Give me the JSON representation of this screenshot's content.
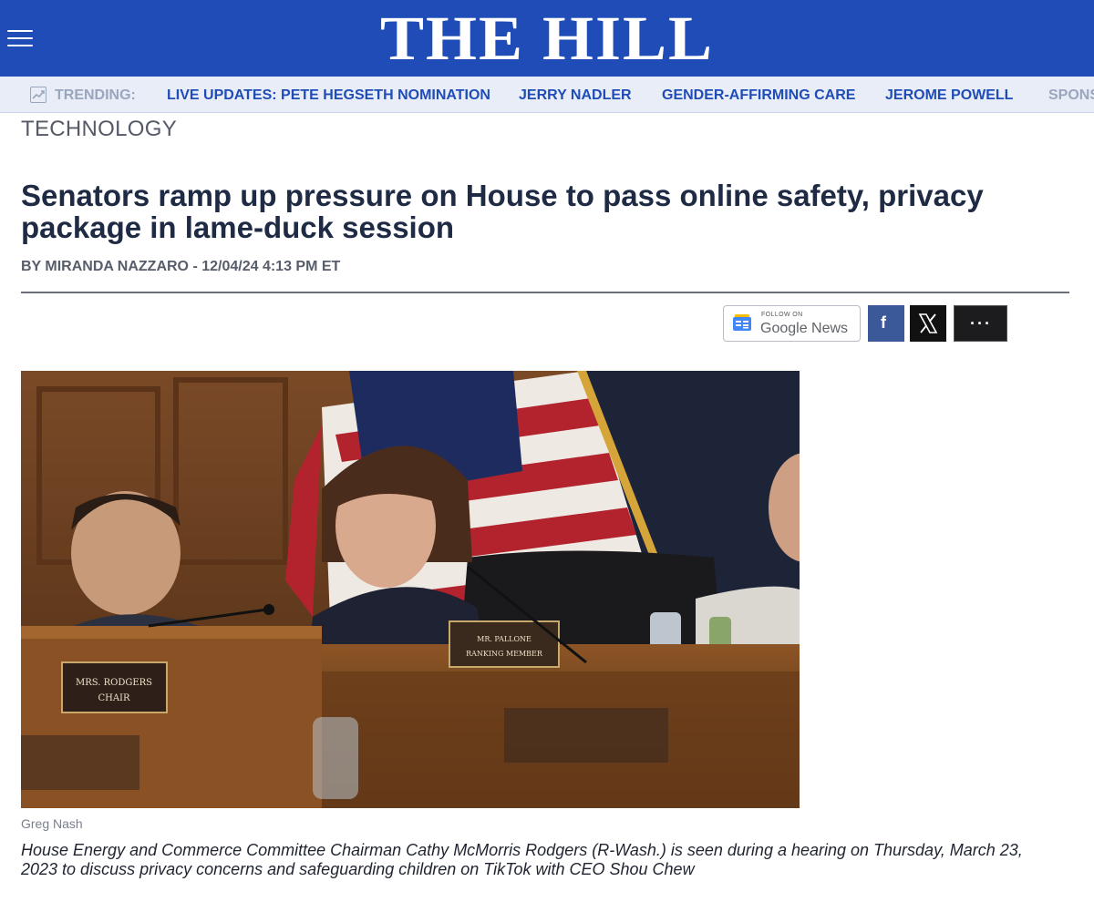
{
  "header": {
    "logo": "THE HILL",
    "menu_icon": "hamburger-menu-icon",
    "background": "#1f4cb7"
  },
  "trending": {
    "label": "TRENDING:",
    "icon": "trending-chart-icon",
    "links": [
      "LIVE UPDATES: PETE HEGSETH NOMINATION",
      "JERRY NADLER",
      "GENDER-AFFIRMING CARE",
      "JEROME POWELL",
      "SPONS"
    ]
  },
  "article": {
    "section": "TECHNOLOGY",
    "headline": "Senators ramp up pressure on House to pass online safety, privacy package in lame-duck session",
    "byline": "BY MIRANDA NAZZARO - 12/04/24 4:13 PM ET",
    "share": {
      "google_follow": "FOLLOW ON",
      "google_name": "Google",
      "google_news": "News",
      "facebook": "f",
      "x_icon": "x-logo-icon",
      "more": "···"
    },
    "photo": {
      "nameplate_left": [
        "MRS. RODGERS",
        "CHAIR"
      ],
      "nameplate_right": [
        "MR. PALLONE",
        "RANKING MEMBER"
      ]
    },
    "photo_credit": "Greg Nash",
    "caption": "House Energy and Commerce Committee Chairman Cathy McMorris Rodgers (R-Wash.) is seen during a hearing  on Thursday, March 23, 2023 to discuss privacy concerns and safeguarding children on TikTok with CEO Shou Chew"
  }
}
